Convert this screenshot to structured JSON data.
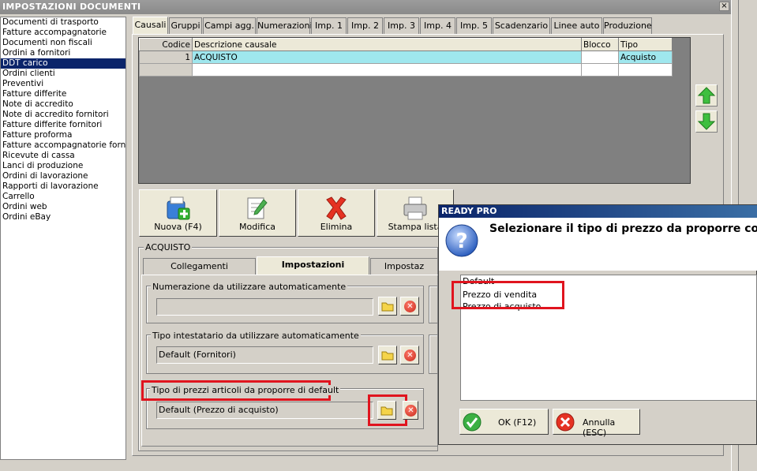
{
  "window": {
    "title": "IMPOSTAZIONI DOCUMENTI",
    "close_glyph": "×"
  },
  "doc_list": {
    "items": [
      "Documenti di trasporto",
      "Fatture accompagnatorie",
      "Documenti non fiscali",
      "Ordini a fornitori",
      "DDT carico",
      "Ordini clienti",
      "Preventivi",
      "Fatture differite",
      "Note di accredito",
      "Note di accredito fornitori",
      "Fatture differite fornitori",
      "Fatture proforma",
      "Fatture accompagnatorie fornito",
      "Ricevute di cassa",
      "Lanci di produzione",
      "Ordini di lavorazione",
      "Rapporti di lavorazione",
      "Carrello",
      "Ordini web",
      "Ordini eBay"
    ],
    "selected_index": 4
  },
  "tabs": [
    "Causali",
    "Gruppi",
    "Campi agg.",
    "Numerazioni",
    "Imp. 1",
    "Imp. 2",
    "Imp. 3",
    "Imp. 4",
    "Imp. 5",
    "Scadenzario",
    "Linee auto",
    "Produzione"
  ],
  "active_tab": "Causali",
  "grid": {
    "columns": [
      "Codice",
      "Descrizione causale",
      "Blocco",
      "Tipo"
    ],
    "rows": [
      {
        "codice": "1",
        "descrizione": "ACQUISTO",
        "blocco": "",
        "tipo": "Acquisto"
      }
    ]
  },
  "actions": {
    "new": "Nuova (F4)",
    "edit": "Modifica",
    "delete": "Elimina",
    "print": "Stampa lista"
  },
  "detail": {
    "group_title": "ACQUISTO",
    "subtabs": [
      "Collegamenti",
      "Impostazioni",
      "Impostaz"
    ],
    "active_subtab": "Impostazioni",
    "numerazione_label": "Numerazione da utilizzare automaticamente",
    "numerazione_value": "",
    "intestatario_label": "Tipo intestatario da utilizzare automaticamente",
    "intestatario_value": "Default (Fornitori)",
    "prezzi_label": "Tipo di prezzi articoli da proporre di default",
    "prezzi_value": "Default (Prezzo di acquisto)"
  },
  "dialog": {
    "title": "READY PRO",
    "message": "Selezionare il tipo di prezzo da proporre come",
    "options": [
      "Default",
      "Prezzo di vendita",
      "Prezzo di acquisto"
    ],
    "ok_label": "OK (F12)",
    "cancel_label": "Annulla (ESC)"
  },
  "colors": {
    "selection": "#0a246a",
    "grid_highlight": "#9fe7ee",
    "annotation_red": "#e0141e",
    "dialog_title": "#0a246a"
  }
}
